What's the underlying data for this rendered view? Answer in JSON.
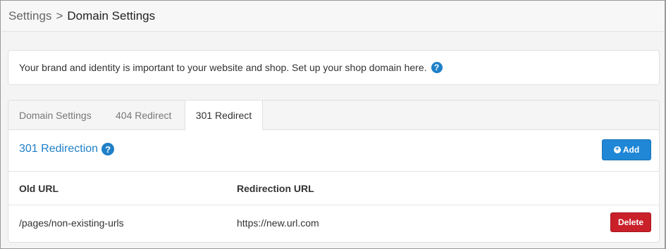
{
  "breadcrumb": {
    "root": "Settings",
    "separator": ">",
    "current": "Domain Settings"
  },
  "info": {
    "text": "Your brand and identity is important to your website and shop. Set up your shop domain here.",
    "help_icon": "?"
  },
  "tabs": [
    {
      "label": "Domain Settings",
      "active": false
    },
    {
      "label": "404 Redirect",
      "active": false
    },
    {
      "label": "301 Redirect",
      "active": true
    }
  ],
  "section": {
    "title": "301 Redirection",
    "help_icon": "?",
    "add_label": "Add",
    "add_icon": "+"
  },
  "table": {
    "columns": [
      "Old URL",
      "Redirection URL"
    ],
    "rows": [
      {
        "old_url": "/pages/non-existing-urls",
        "redirection_url": "https://new.url.com",
        "delete_label": "Delete"
      }
    ]
  },
  "colors": {
    "accent": "#1f80c8",
    "add_button": "#1f87d6",
    "delete_button": "#c9202a"
  }
}
